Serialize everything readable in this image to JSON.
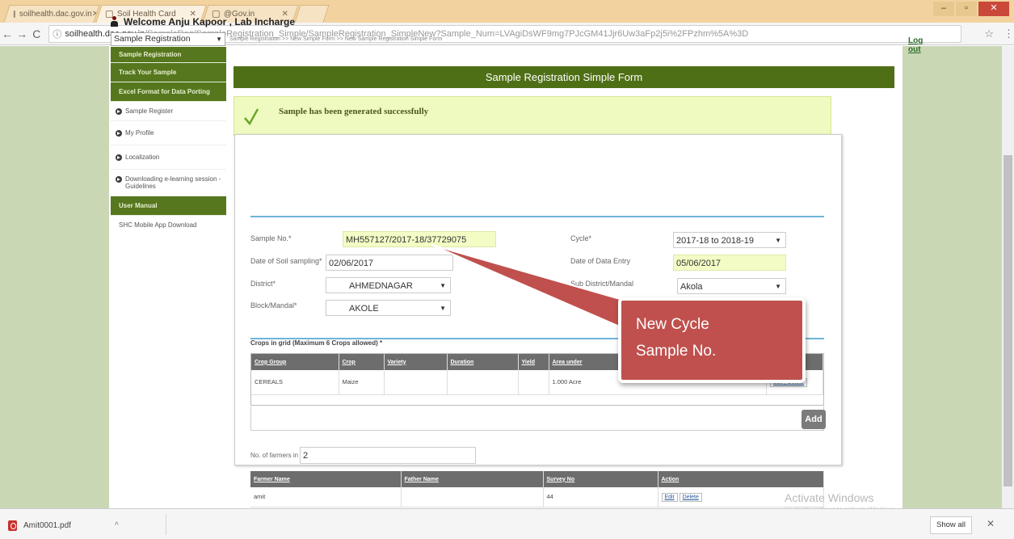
{
  "browser": {
    "tabs": [
      {
        "title": "soilhealth.dac.gov.in",
        "active": false
      },
      {
        "title": "Soil Health Card",
        "active": true
      },
      {
        "title": "@Gov.in",
        "active": false
      }
    ],
    "url_host": "soilhealth.dac.gov.in",
    "url_path": "/SampleReg/SampleRegistration_Simple/SampleRegistration_SimpleNew?Sample_Num=LVAgiDsWF9mg7PJcGM41Jjr6Uw3aFp2j5i%2FPzhm%5A%3D",
    "window_buttons": {
      "minimize": "–",
      "maximize": "▫",
      "close": "✕"
    }
  },
  "header": {
    "welcome": "Welcome Anju Kapoor , Lab Incharge",
    "logout": "Log out",
    "module_select": "Sample Registration",
    "breadcrumb": "Sample Registration >> New Simple Form >> New Sample Registration Simple Form"
  },
  "leftmenu": {
    "green_items": [
      "Sample Registration",
      "Track Your Sample",
      "Excel Format for Data Porting"
    ],
    "items": [
      {
        "label": "Sample Register",
        "icon": true
      },
      {
        "label": "My Profile",
        "icon": true
      },
      {
        "label": "Localization",
        "icon": true
      },
      {
        "label": "Downloading e-learning session - Guidelines",
        "icon": true
      }
    ],
    "user_manual": "User Manual",
    "mobile_app": "SHC Mobile App Download"
  },
  "form": {
    "title": "Sample Registration Simple Form",
    "success_message": "Sample has been generated successfully",
    "fields": {
      "sample_no_label": "Sample No.*",
      "sample_no": "MH557127/2017-18/37729075",
      "cycle_label": "Cycle*",
      "cycle": "2017-18 to 2018-19",
      "soil_date_label": "Date of Soil sampling*",
      "soil_date": "02/06/2017",
      "entry_date_label": "Date of Data Entry",
      "entry_date": "05/06/2017",
      "district_label": "District*",
      "district": "AHMEDNAGAR",
      "subdistrict_label": "Sub District/Mandal",
      "subdistrict": "Akola",
      "block_label": "Block/Mandal*",
      "block": "AKOLE"
    },
    "crops": {
      "title": "Crops in grid (Maximum 6 Crops allowed) *",
      "columns": [
        "Crop Group",
        "Crop",
        "Variety",
        "Duration",
        "Yield",
        "Area under"
      ],
      "rows": [
        [
          "CEREALS",
          "Maize",
          "",
          "",
          "",
          "1.000 Acre"
        ]
      ],
      "row_action": "Edit | Delete",
      "add_label": "Add"
    },
    "farmers": {
      "count_label": "No. of farmers in a grid*",
      "count": "2",
      "columns": [
        "Farmer Name",
        "Father Name",
        "Survey No",
        "Action"
      ],
      "rows": [
        [
          "amit",
          "",
          "44",
          ""
        ]
      ],
      "edit": "Edit",
      "delete": "Delete"
    }
  },
  "callout": {
    "line1": "New Cycle",
    "line2": "Sample No."
  },
  "watermark": {
    "line1": "Activate Windows",
    "line2": "Go to PC settings to activate Windows."
  },
  "downloads": {
    "file": "Amit0001.pdf",
    "show_all": "Show all",
    "close": "✕"
  },
  "colors": {
    "accent_green": "#4f6f16",
    "callout_red": "#c0504d",
    "success_bg": "#eefabf"
  }
}
